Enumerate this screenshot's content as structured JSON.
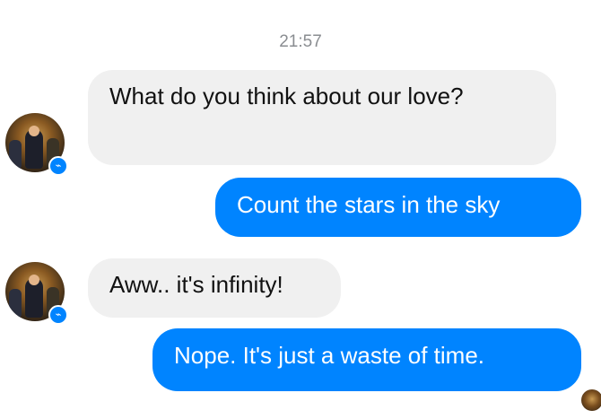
{
  "timestamp": "21:57",
  "messages": [
    {
      "direction": "incoming",
      "text": "What do you think about our love?"
    },
    {
      "direction": "outgoing",
      "text": "Count the stars in the sky"
    },
    {
      "direction": "incoming",
      "text": "Aww.. it's infinity!"
    },
    {
      "direction": "outgoing",
      "text": "Nope. It's just a waste of time."
    }
  ],
  "icons": {
    "contact_avatar": "contact-avatar-photo",
    "messenger_badge": "messenger-badge-icon",
    "seen_avatar": "seen-avatar-photo"
  },
  "colors": {
    "outgoing_bubble": "#0084ff",
    "incoming_bubble": "#f0f0f0",
    "timestamp_text": "#8a8d91"
  }
}
